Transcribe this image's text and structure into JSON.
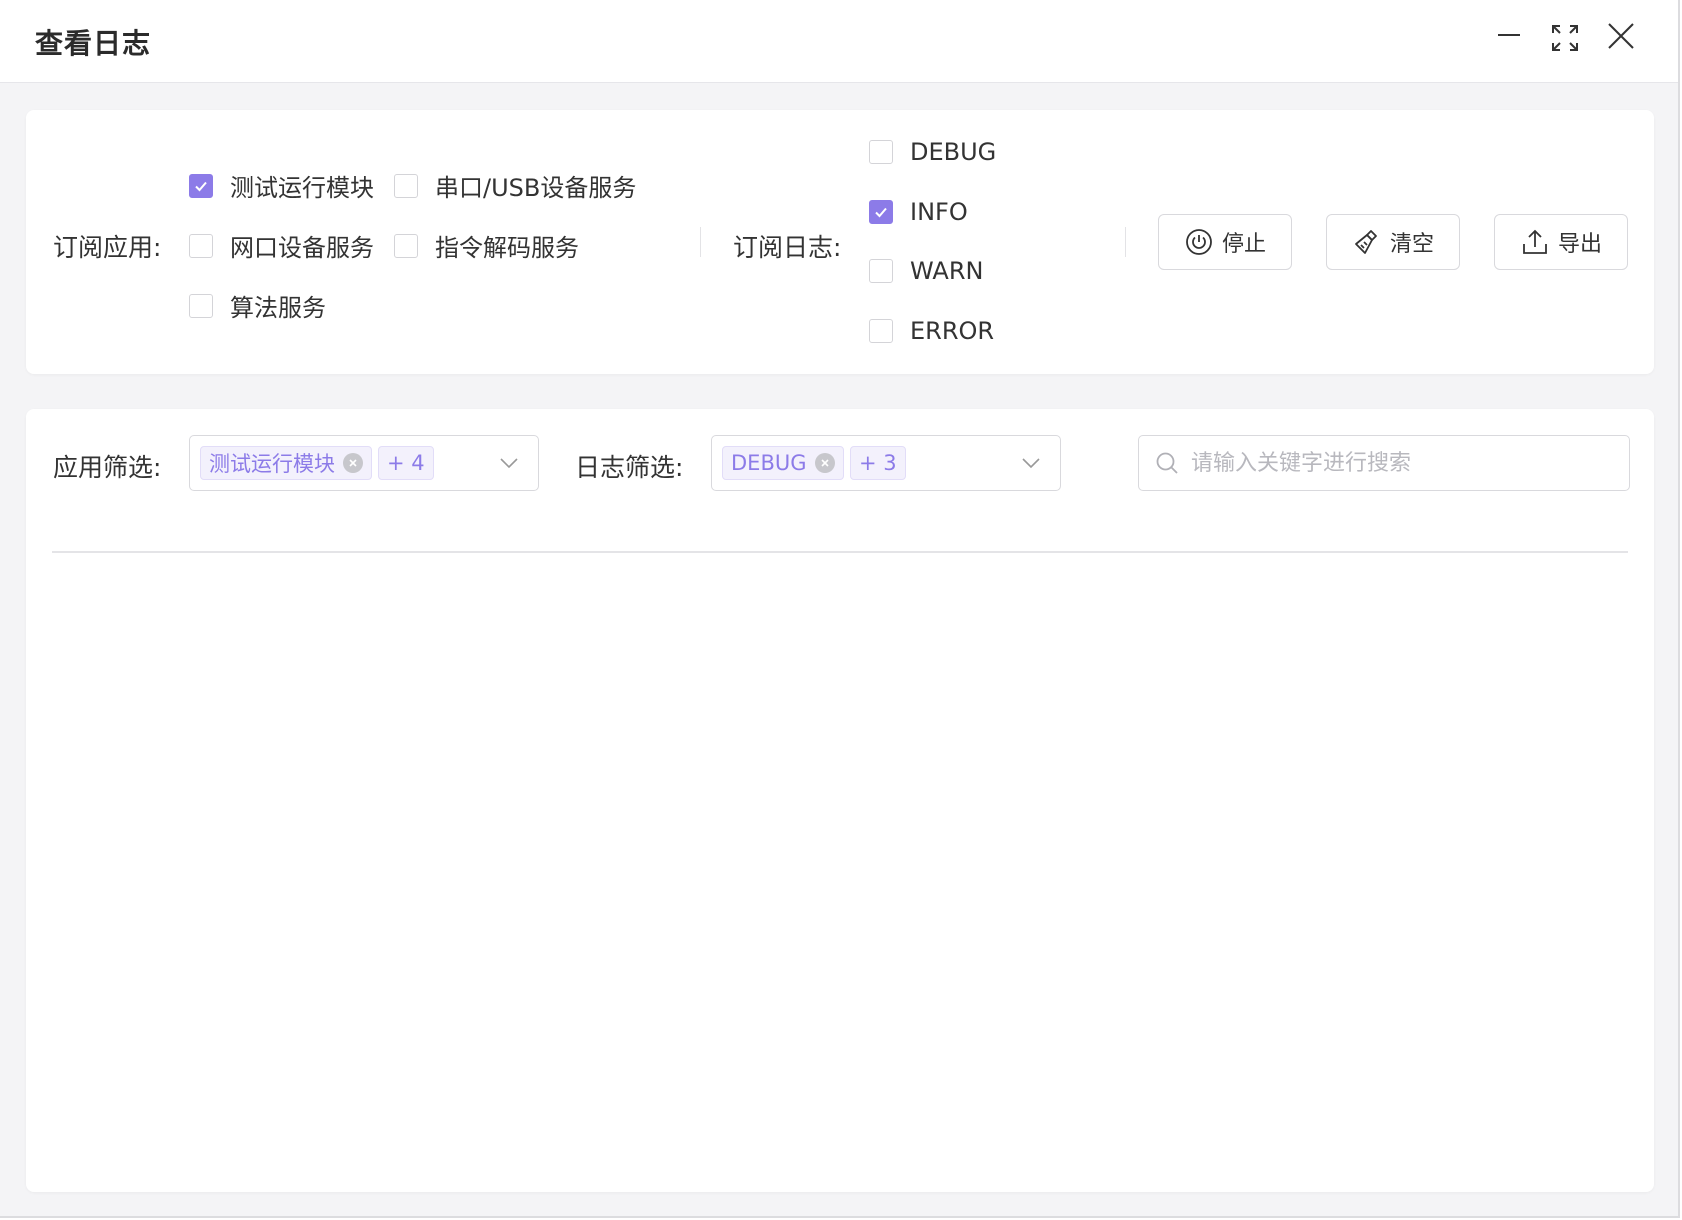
{
  "window": {
    "title": "查看日志"
  },
  "subscribe": {
    "app_label": "订阅应用:",
    "apps": [
      {
        "label": "测试运行模块",
        "checked": true
      },
      {
        "label": "串口/USB设备服务",
        "checked": false
      },
      {
        "label": "网口设备服务",
        "checked": false
      },
      {
        "label": "指令解码服务",
        "checked": false
      },
      {
        "label": "算法服务",
        "checked": false
      }
    ],
    "log_label": "订阅日志:",
    "levels": [
      {
        "label": "DEBUG",
        "checked": false
      },
      {
        "label": "INFO",
        "checked": true
      },
      {
        "label": "WARN",
        "checked": false
      },
      {
        "label": "ERROR",
        "checked": false
      }
    ]
  },
  "actions": {
    "stop_label": "停止",
    "clear_label": "清空",
    "export_label": "导出"
  },
  "filters": {
    "app_filter_label": "应用筛选:",
    "app_tag": "测试运行模块",
    "app_more": "+ 4",
    "log_filter_label": "日志筛选:",
    "log_tag": "DEBUG",
    "log_more": "+ 3",
    "search_placeholder": "请输入关键字进行搜索",
    "search_value": ""
  },
  "colors": {
    "accent": "#8c7be8",
    "tag_bg": "#f3f1fc",
    "border": "#d9d9dd"
  },
  "icons": {
    "minimize": "minimize-icon",
    "maximize": "maximize-icon",
    "close": "close-icon",
    "stop": "power-icon",
    "clear": "broom-icon",
    "export": "upload-icon",
    "search": "search-icon"
  }
}
